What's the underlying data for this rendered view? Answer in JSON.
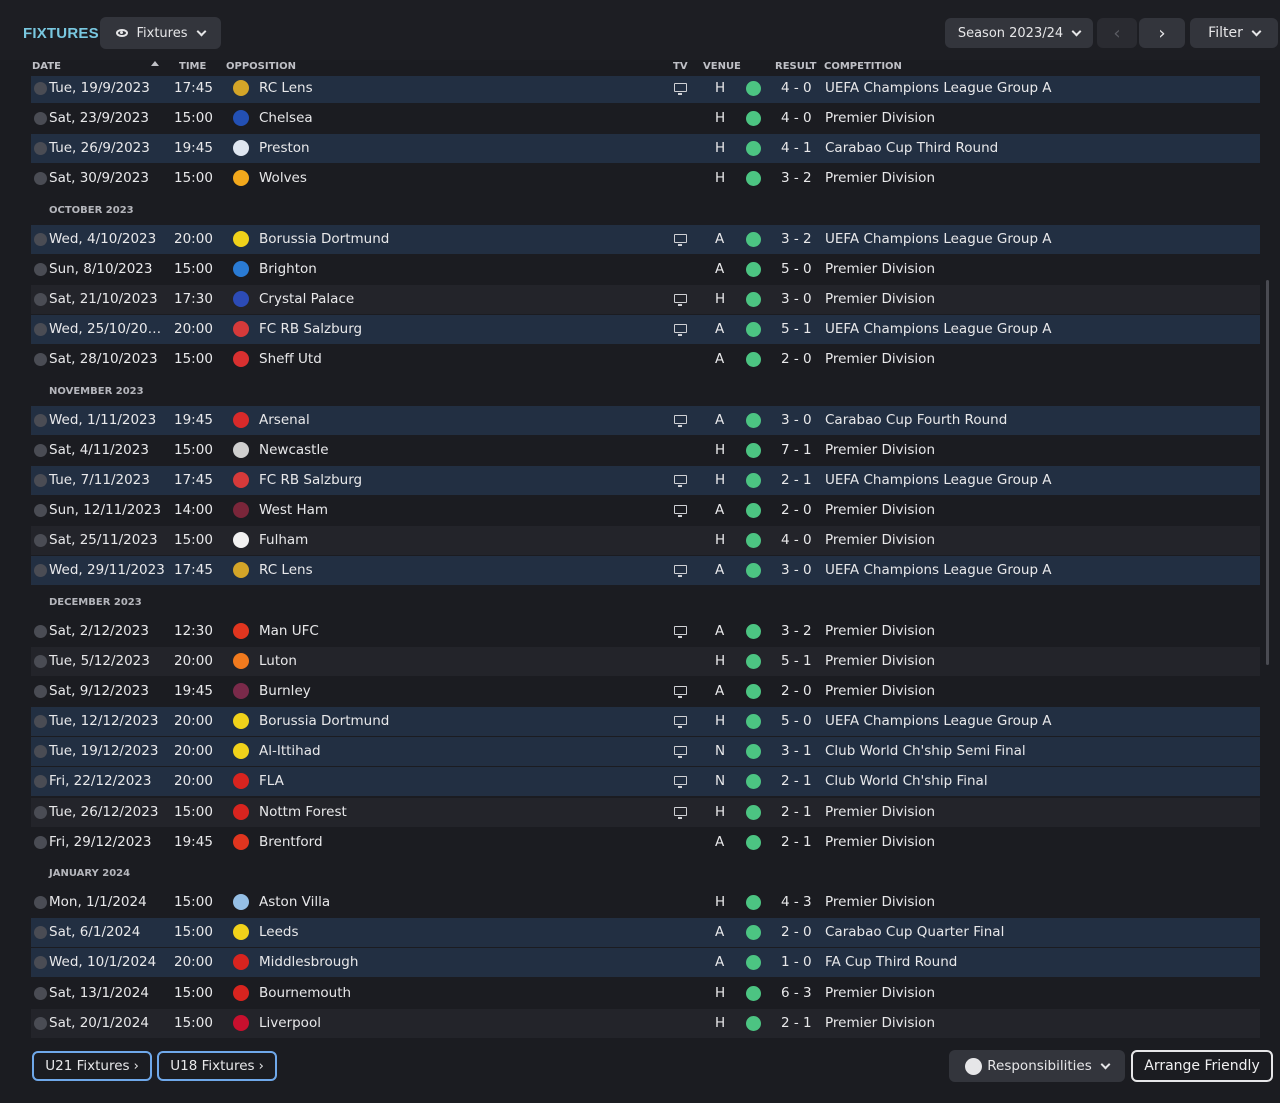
{
  "header": {
    "title": "FIXTURES",
    "view_dropdown": "Fixtures",
    "season_dropdown": "Season 2023/24",
    "prev_glyph": "‹",
    "next_glyph": "›",
    "filter_label": "Filter"
  },
  "columns": {
    "date": "DATE",
    "time": "TIME",
    "opposition": "OPPOSITION",
    "tv": "TV",
    "venue": "VENUE",
    "result": "RESULT",
    "competition": "COMPETITION"
  },
  "colors": {
    "accent": "#79c8e0",
    "win_dot": "#4cc482",
    "cl_row": "#222f42",
    "button_outline": "#6fa8ea"
  },
  "items": [
    {
      "kind": "match",
      "style": "cl",
      "date": "Tue, 19/9/2023",
      "time": "17:45",
      "crest": "#d4a528",
      "opp": "RC Lens",
      "tv": true,
      "venue": "H",
      "result": "4 - 0",
      "comp": "UEFA Champions League Group A"
    },
    {
      "kind": "match",
      "style": "plain",
      "date": "Sat, 23/9/2023",
      "time": "15:00",
      "crest": "#2350b4",
      "opp": "Chelsea",
      "tv": false,
      "venue": "H",
      "result": "4 - 0",
      "comp": "Premier Division"
    },
    {
      "kind": "match",
      "style": "cl",
      "date": "Tue, 26/9/2023",
      "time": "19:45",
      "crest": "#dfe6f0",
      "opp": "Preston",
      "tv": false,
      "venue": "H",
      "result": "4 - 1",
      "comp": "Carabao Cup Third Round"
    },
    {
      "kind": "match",
      "style": "plain",
      "date": "Sat, 30/9/2023",
      "time": "15:00",
      "crest": "#f2a81c",
      "opp": "Wolves",
      "tv": false,
      "venue": "H",
      "result": "3 - 2",
      "comp": "Premier Division"
    },
    {
      "kind": "month",
      "label": "OCTOBER 2023"
    },
    {
      "kind": "match",
      "style": "cl",
      "date": "Wed, 4/10/2023",
      "time": "20:00",
      "crest": "#f1d21a",
      "opp": "Borussia Dortmund",
      "tv": true,
      "venue": "A",
      "result": "3 - 2",
      "comp": "UEFA Champions League Group A"
    },
    {
      "kind": "match",
      "style": "plain",
      "date": "Sun, 8/10/2023",
      "time": "15:00",
      "crest": "#2a7bd4",
      "opp": "Brighton",
      "tv": false,
      "venue": "A",
      "result": "5 - 0",
      "comp": "Premier Division"
    },
    {
      "kind": "match",
      "style": "shaded",
      "date": "Sat, 21/10/2023",
      "time": "17:30",
      "crest": "#2c4bb6",
      "opp": "Crystal Palace",
      "tv": true,
      "venue": "H",
      "result": "3 - 0",
      "comp": "Premier Division"
    },
    {
      "kind": "match",
      "style": "cl",
      "date": "Wed, 25/10/20…",
      "time": "20:00",
      "crest": "#d63a3a",
      "opp": "FC RB Salzburg",
      "tv": true,
      "venue": "A",
      "result": "5 - 1",
      "comp": "UEFA Champions League Group A"
    },
    {
      "kind": "match",
      "style": "plain",
      "date": "Sat, 28/10/2023",
      "time": "15:00",
      "crest": "#d83030",
      "opp": "Sheff Utd",
      "tv": false,
      "venue": "A",
      "result": "2 - 0",
      "comp": "Premier Division"
    },
    {
      "kind": "month",
      "label": "NOVEMBER 2023"
    },
    {
      "kind": "match",
      "style": "cl",
      "date": "Wed, 1/11/2023",
      "time": "19:45",
      "crest": "#d82a2a",
      "opp": "Arsenal",
      "tv": true,
      "venue": "A",
      "result": "3 - 0",
      "comp": "Carabao Cup Fourth Round"
    },
    {
      "kind": "match",
      "style": "plain",
      "date": "Sat, 4/11/2023",
      "time": "15:00",
      "crest": "#cfcfcf",
      "opp": "Newcastle",
      "tv": false,
      "venue": "H",
      "result": "7 - 1",
      "comp": "Premier Division"
    },
    {
      "kind": "match",
      "style": "cl",
      "date": "Tue, 7/11/2023",
      "time": "17:45",
      "crest": "#d63a3a",
      "opp": "FC RB Salzburg",
      "tv": true,
      "venue": "H",
      "result": "2 - 1",
      "comp": "UEFA Champions League Group A"
    },
    {
      "kind": "match",
      "style": "plain",
      "date": "Sun, 12/11/2023",
      "time": "14:00",
      "crest": "#7a263a",
      "opp": "West Ham",
      "tv": true,
      "venue": "A",
      "result": "2 - 0",
      "comp": "Premier Division"
    },
    {
      "kind": "match",
      "style": "shaded",
      "date": "Sat, 25/11/2023",
      "time": "15:00",
      "crest": "#f2f2f2",
      "opp": "Fulham",
      "tv": false,
      "venue": "H",
      "result": "4 - 0",
      "comp": "Premier Division"
    },
    {
      "kind": "match",
      "style": "cl",
      "date": "Wed, 29/11/2023",
      "time": "17:45",
      "crest": "#d4a528",
      "opp": "RC Lens",
      "tv": true,
      "venue": "A",
      "result": "3 - 0",
      "comp": "UEFA Champions League Group A"
    },
    {
      "kind": "month",
      "label": "DECEMBER 2023"
    },
    {
      "kind": "match",
      "style": "plain",
      "date": "Sat, 2/12/2023",
      "time": "12:30",
      "crest": "#e0351f",
      "opp": "Man UFC",
      "tv": true,
      "venue": "A",
      "result": "3 - 2",
      "comp": "Premier Division"
    },
    {
      "kind": "match",
      "style": "shaded",
      "date": "Tue, 5/12/2023",
      "time": "20:00",
      "crest": "#f07a1e",
      "opp": "Luton",
      "tv": false,
      "venue": "H",
      "result": "5 - 1",
      "comp": "Premier Division"
    },
    {
      "kind": "match",
      "style": "plain",
      "date": "Sat, 9/12/2023",
      "time": "19:45",
      "crest": "#7a2a4a",
      "opp": "Burnley",
      "tv": true,
      "venue": "A",
      "result": "2 - 0",
      "comp": "Premier Division"
    },
    {
      "kind": "match",
      "style": "cl",
      "date": "Tue, 12/12/2023",
      "time": "20:00",
      "crest": "#f1d21a",
      "opp": "Borussia Dortmund",
      "tv": true,
      "venue": "H",
      "result": "5 - 0",
      "comp": "UEFA Champions League Group A"
    },
    {
      "kind": "match",
      "style": "cl",
      "date": "Tue, 19/12/2023",
      "time": "20:00",
      "crest": "#f1d21a",
      "opp": "Al-Ittihad",
      "tv": true,
      "venue": "N",
      "result": "3 - 1",
      "comp": "Club World Ch'ship Semi Final"
    },
    {
      "kind": "match",
      "style": "cl",
      "date": "Fri, 22/12/2023",
      "time": "20:00",
      "crest": "#d8241f",
      "opp": "FLA",
      "tv": true,
      "venue": "N",
      "result": "2 - 1",
      "comp": "Club World Ch'ship Final"
    },
    {
      "kind": "match",
      "style": "shaded",
      "date": "Tue, 26/12/2023",
      "time": "15:00",
      "crest": "#d8241f",
      "opp": "Nottm Forest",
      "tv": true,
      "venue": "H",
      "result": "2 - 1",
      "comp": "Premier Division"
    },
    {
      "kind": "match",
      "style": "plain",
      "date": "Fri, 29/12/2023",
      "time": "19:45",
      "crest": "#e0351f",
      "opp": "Brentford",
      "tv": false,
      "venue": "A",
      "result": "2 - 1",
      "comp": "Premier Division"
    },
    {
      "kind": "month",
      "label": "JANUARY 2024"
    },
    {
      "kind": "match",
      "style": "plain",
      "date": "Mon, 1/1/2024",
      "time": "15:00",
      "crest": "#95bfe5",
      "opp": "Aston Villa",
      "tv": false,
      "venue": "H",
      "result": "4 - 3",
      "comp": "Premier Division"
    },
    {
      "kind": "match",
      "style": "cl",
      "date": "Sat, 6/1/2024",
      "time": "15:00",
      "crest": "#f1d21a",
      "opp": "Leeds",
      "tv": false,
      "venue": "A",
      "result": "2 - 0",
      "comp": "Carabao Cup Quarter Final"
    },
    {
      "kind": "match",
      "style": "cl",
      "date": "Wed, 10/1/2024",
      "time": "20:00",
      "crest": "#d8241f",
      "opp": "Middlesbrough",
      "tv": false,
      "venue": "A",
      "result": "1 - 0",
      "comp": "FA Cup Third Round"
    },
    {
      "kind": "match",
      "style": "plain",
      "date": "Sat, 13/1/2024",
      "time": "15:00",
      "crest": "#d8241f",
      "opp": "Bournemouth",
      "tv": false,
      "venue": "H",
      "result": "6 - 3",
      "comp": "Premier Division"
    },
    {
      "kind": "match",
      "style": "shaded",
      "date": "Sat, 20/1/2024",
      "time": "15:00",
      "crest": "#c8102e",
      "opp": "Liverpool",
      "tv": false,
      "venue": "H",
      "result": "2 - 1",
      "comp": "Premier Division"
    }
  ],
  "footer": {
    "u21": "U21 Fixtures",
    "u18": "U18 Fixtures",
    "arrow": "›",
    "responsibilities": "Responsibilities",
    "arrange": "Arrange Friendly"
  }
}
